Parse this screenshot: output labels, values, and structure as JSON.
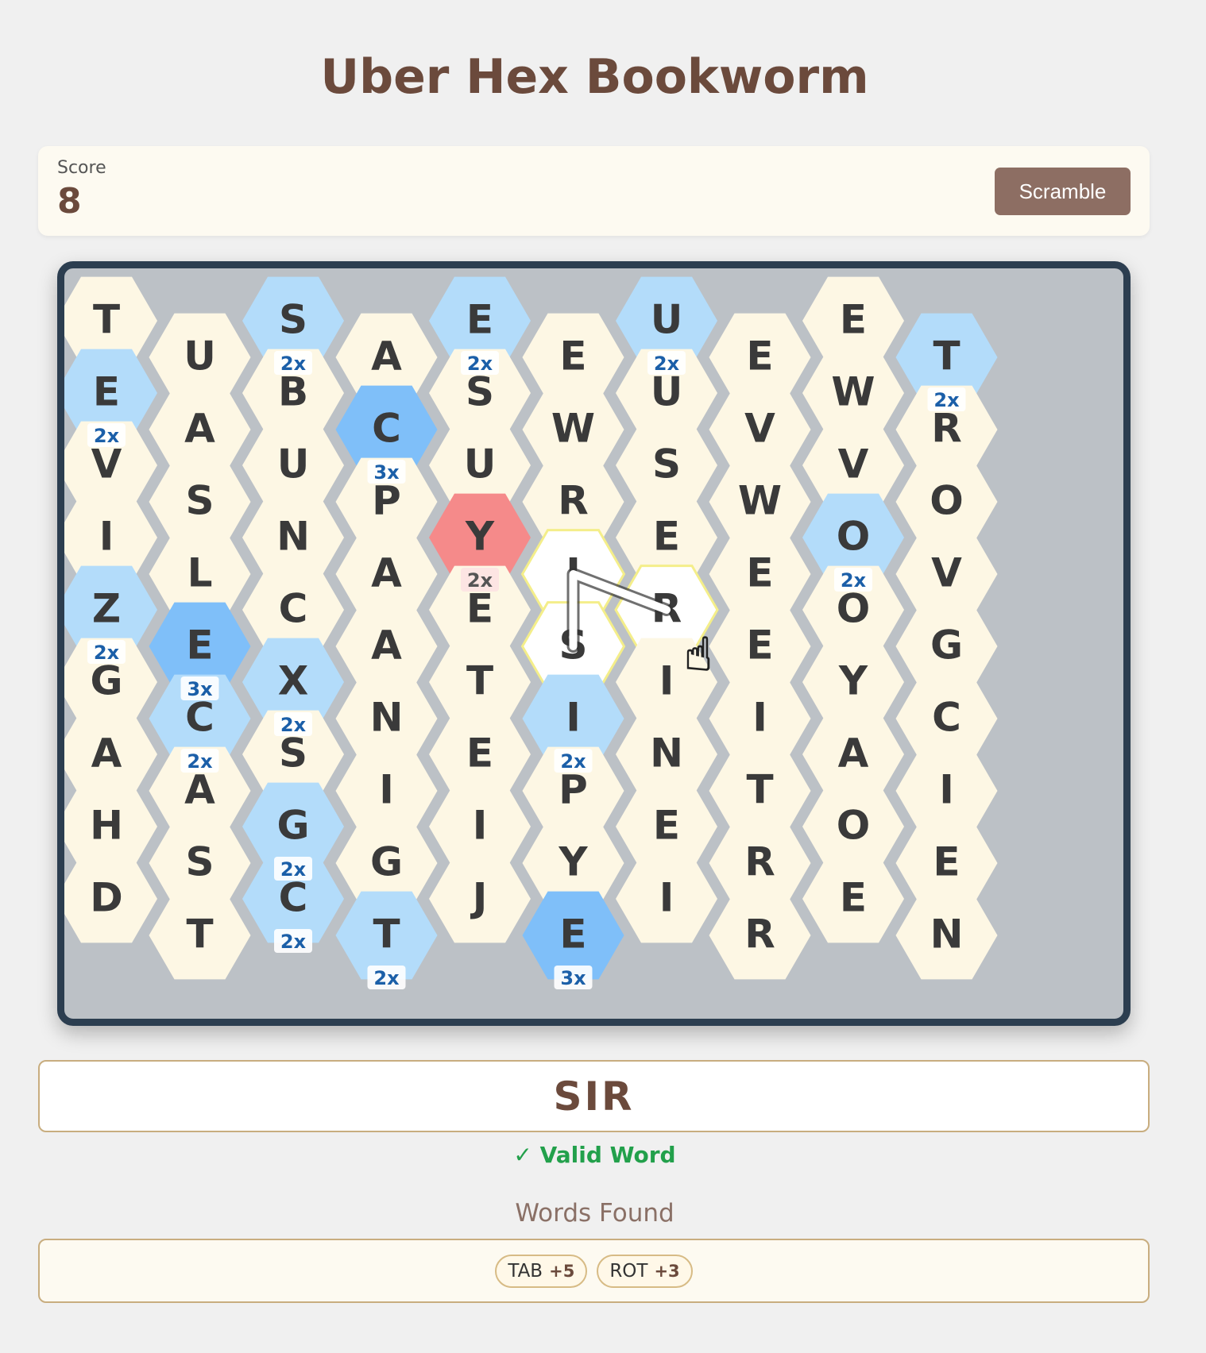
{
  "title": "Uber Hex Bookworm",
  "score": {
    "label": "Score",
    "value": "8"
  },
  "scramble_label": "Scramble",
  "grid": [
    "TUSAEEUEET",
    "EABCSWUVWR",
    "VSUPURSWVO",
    "ILNAYIEEOV",
    "ZECAESREOG",
    "GCXNTIIIYC",
    "AASIEPNTAI",
    "HSGGIYEROE",
    "DTCTJEIREN"
  ],
  "multipliers": [
    {
      "row": 0,
      "col": 2,
      "label": "2x"
    },
    {
      "row": 0,
      "col": 4,
      "label": "2x"
    },
    {
      "row": 0,
      "col": 6,
      "label": "2x"
    },
    {
      "row": 0,
      "col": 9,
      "label": "2x"
    },
    {
      "row": 1,
      "col": 0,
      "label": "2x"
    },
    {
      "row": 1,
      "col": 3,
      "label": "3x"
    },
    {
      "row": 3,
      "col": 8,
      "label": "2x"
    },
    {
      "row": 4,
      "col": 0,
      "label": "2x"
    },
    {
      "row": 4,
      "col": 1,
      "label": "3x"
    },
    {
      "row": 5,
      "col": 1,
      "label": "2x"
    },
    {
      "row": 5,
      "col": 2,
      "label": "2x"
    },
    {
      "row": 5,
      "col": 5,
      "label": "2x"
    },
    {
      "row": 7,
      "col": 2,
      "label": "2x"
    },
    {
      "row": 8,
      "col": 2,
      "label": "2x"
    },
    {
      "row": 8,
      "col": 3,
      "label": "2x"
    },
    {
      "row": 8,
      "col": 5,
      "label": "3x"
    }
  ],
  "burning_tiles": [
    {
      "row": 3,
      "col": 4,
      "label": "2x"
    }
  ],
  "selected_path": [
    {
      "row": 4,
      "col": 5
    },
    {
      "row": 3,
      "col": 5
    },
    {
      "row": 4,
      "col": 6
    }
  ],
  "colors": {
    "tile": "#fdf7e4",
    "mult_2x": "#b3dcfa",
    "mult_3x": "#7fbff9",
    "burning": "#f58a8a",
    "selected": "#ffffff",
    "selected_border": "#f4ee8a",
    "multiplier_text": "#1b5fa8",
    "letter": "#3a3a3a"
  },
  "current_word": "SIR",
  "status": "✓ Valid Word",
  "words_found_title": "Words Found",
  "words_found": [
    {
      "word": "TAB",
      "points": "+5"
    },
    {
      "word": "ROT",
      "points": "+3"
    }
  ]
}
